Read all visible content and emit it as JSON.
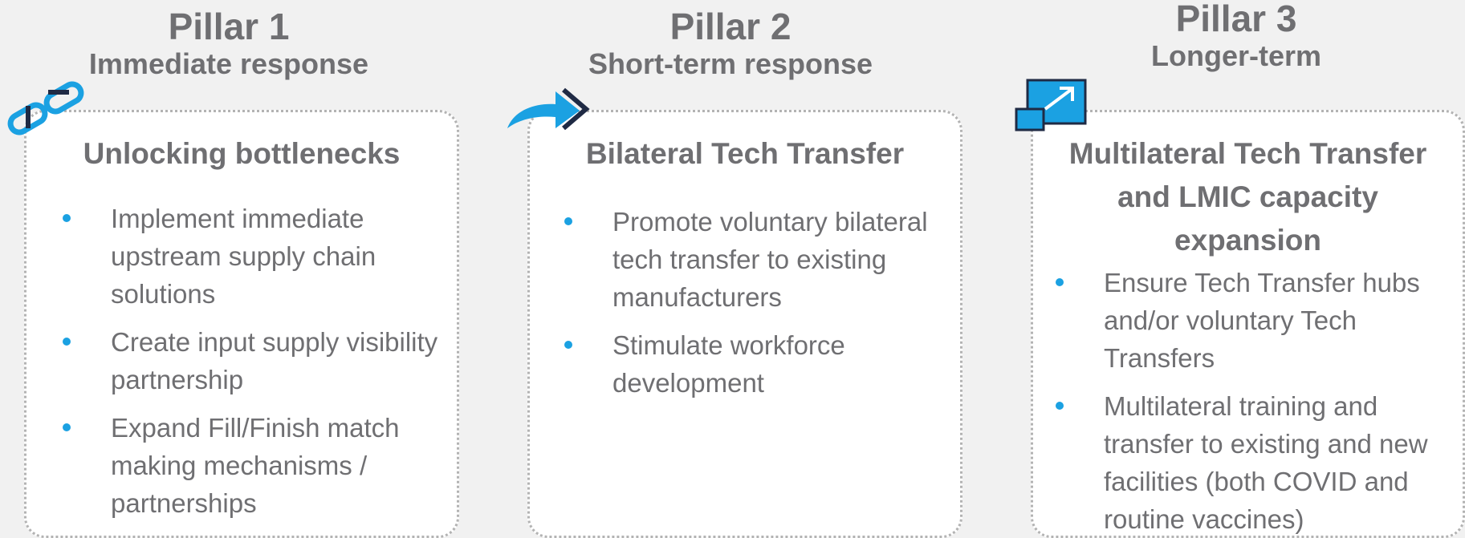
{
  "pillars": [
    {
      "number": "Pillar 1",
      "subtitle": "Immediate response",
      "card_title": "Unlocking bottlenecks",
      "icon": "chain-link-icon",
      "bullets": [
        "Implement immediate upstream supply chain solutions",
        "Create input supply visibility partnership",
        "Expand Fill/Finish match making mechanisms / partnerships"
      ]
    },
    {
      "number": "Pillar 2",
      "subtitle": "Short-term response",
      "card_title": "Bilateral Tech Transfer",
      "icon": "forward-arrow-icon",
      "bullets": [
        "Promote voluntary bilateral tech transfer to existing manufacturers",
        "Stimulate workforce development"
      ]
    },
    {
      "number": "Pillar 3",
      "subtitle": "Longer-term",
      "card_title": "Multilateral Tech Transfer and LMIC capacity expansion",
      "icon": "expand-icon",
      "bullets": [
        "Ensure Tech Transfer hubs and/or voluntary Tech Transfers",
        "Multilateral training and transfer to existing and new facilities (both COVID and routine vaccines)"
      ]
    }
  ],
  "colors": {
    "accent": "#1ba1e2",
    "dark_navy": "#1f2a44",
    "text": "#6f6f72",
    "card_border": "#b3b3b3"
  }
}
